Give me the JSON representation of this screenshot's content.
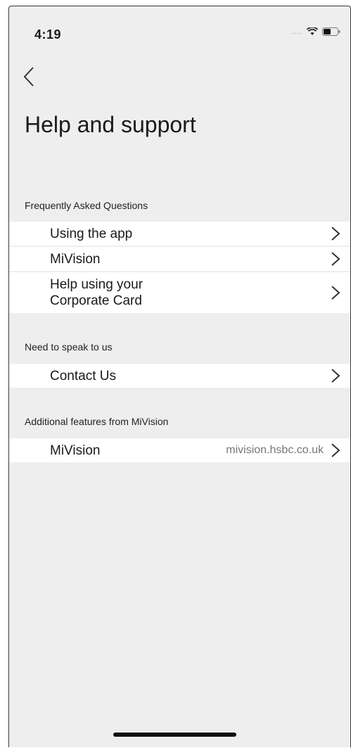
{
  "status_bar": {
    "time": "4:19",
    "signal": "...."
  },
  "header": {
    "title": "Help and support"
  },
  "sections": [
    {
      "title": "Frequently Asked Questions",
      "items": [
        {
          "label": "Using the app"
        },
        {
          "label": "MiVision"
        },
        {
          "label": "Help using your\nCorporate Card"
        }
      ]
    },
    {
      "title": "Need to speak to us",
      "items": [
        {
          "label": "Contact Us"
        }
      ]
    },
    {
      "title": "Additional features from MiVision",
      "items": [
        {
          "label": "MiVision",
          "value": "mivision.hsbc.co.uk"
        }
      ]
    }
  ],
  "icons": {
    "back": "chevron-left-icon",
    "row_chevron": "chevron-right-icon",
    "wifi": "wifi-icon",
    "battery": "battery-icon"
  }
}
